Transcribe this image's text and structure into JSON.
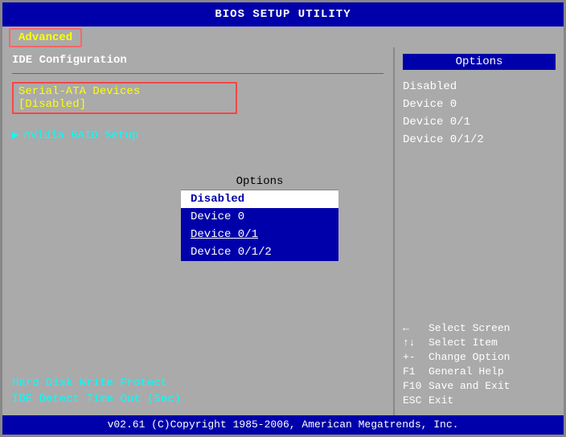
{
  "header": {
    "title": "BIOS SETUP UTILITY"
  },
  "tabs": [
    {
      "label": "Advanced",
      "active": true
    }
  ],
  "left": {
    "section_title": "IDE Configuration",
    "selected_item_label": "Serial-ATA Devices",
    "selected_item_value": "[Disabled]",
    "menu_items": [
      {
        "label": "nVidia RAID Setup",
        "has_arrow": true
      }
    ],
    "bottom_items": [
      {
        "label": "Hard Disk Write Protect"
      },
      {
        "label": "IDE Detect Time Out (Sec)"
      }
    ]
  },
  "popup": {
    "header": "Options",
    "items": [
      {
        "label": "Disabled",
        "selected": true
      },
      {
        "label": "Device 0",
        "selected": false
      },
      {
        "label": "Device 0/1",
        "selected": false,
        "underline": true
      },
      {
        "label": "Device 0/1/2",
        "selected": false
      }
    ]
  },
  "right": {
    "options_header": "Options",
    "options": [
      {
        "label": "Disabled"
      },
      {
        "label": "Device 0"
      },
      {
        "label": "Device 0/1"
      },
      {
        "label": "Device 0/1/2"
      }
    ],
    "help": [
      {
        "key": "←",
        "desc": "Select Screen"
      },
      {
        "key": "↑↓",
        "desc": "Select Item"
      },
      {
        "key": "+-",
        "desc": "Change Option"
      },
      {
        "key": "F1",
        "desc": "General Help"
      },
      {
        "key": "F10",
        "desc": "Save and Exit"
      },
      {
        "key": "ESC",
        "desc": "Exit"
      }
    ]
  },
  "footer": {
    "text": "v02.61  (C)Copyright 1985-2006, American Megatrends, Inc."
  }
}
